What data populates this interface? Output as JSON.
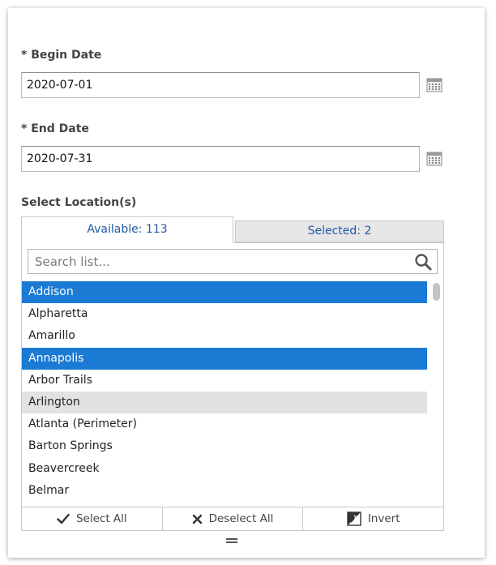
{
  "begin_date": {
    "label": "* Begin Date",
    "value": "2020-07-01",
    "picker_icon": "calendar-icon"
  },
  "end_date": {
    "label": "* End Date",
    "value": "2020-07-31",
    "picker_icon": "calendar-icon"
  },
  "location": {
    "label": "Select Location(s)",
    "tabs": {
      "available": "Available: 113",
      "selected": "Selected: 2"
    },
    "search": {
      "placeholder": "Search list...",
      "icon": "search-icon"
    },
    "items": [
      {
        "label": "Addison",
        "selected": true
      },
      {
        "label": "Alpharetta",
        "selected": false
      },
      {
        "label": "Amarillo",
        "selected": false
      },
      {
        "label": "Annapolis",
        "selected": true
      },
      {
        "label": "Arbor Trails",
        "selected": false
      },
      {
        "label": "Arlington",
        "selected": false,
        "hovered": true
      },
      {
        "label": "Atlanta (Perimeter)",
        "selected": false
      },
      {
        "label": "Barton Springs",
        "selected": false
      },
      {
        "label": "Beavercreek",
        "selected": false
      },
      {
        "label": "Belmar",
        "selected": false
      }
    ],
    "actions": {
      "select_all": "Select All",
      "deselect_all": "Deselect All",
      "invert": "Invert"
    }
  },
  "colors": {
    "selected_row": "#1b7bd4",
    "hover_row": "#e2e2e2",
    "tab_text": "#1f5aa6",
    "inactive_tab": "#e6e6e6"
  }
}
